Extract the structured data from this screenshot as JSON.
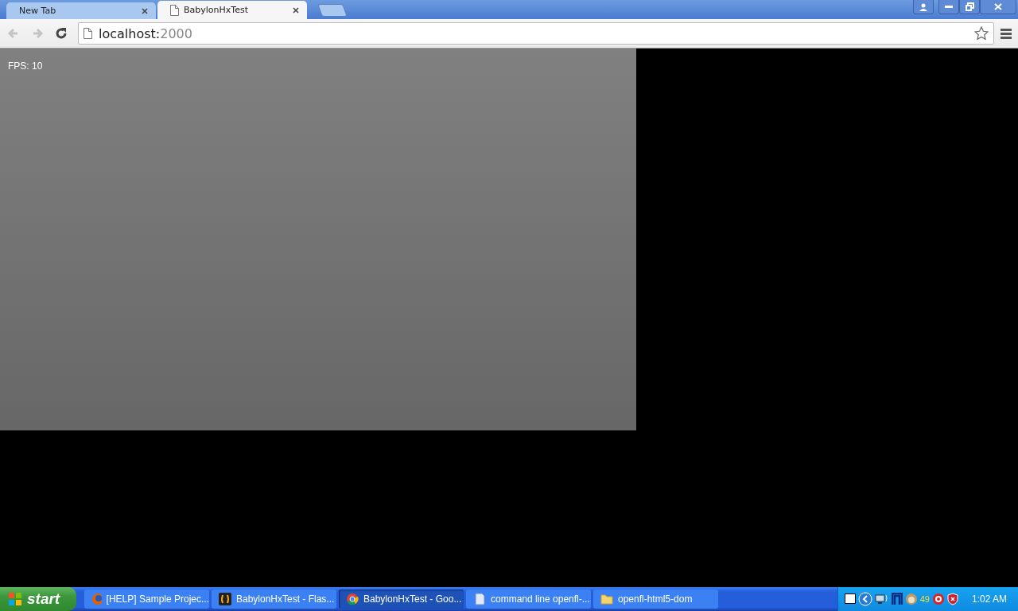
{
  "tabs": [
    {
      "title": "New Tab",
      "selected": false
    },
    {
      "title": "BabylonHxTest",
      "selected": true
    }
  ],
  "nav_buttons": [
    {
      "kind": "back",
      "disabled": true
    },
    {
      "kind": "forward",
      "disabled": true
    },
    {
      "kind": "reload",
      "disabled": false
    }
  ],
  "address": {
    "host": "localhost:",
    "port": "2000"
  },
  "page": {
    "fps": "FPS: 10"
  },
  "taskbar": {
    "start": "start",
    "items": [
      {
        "kind": "firefox",
        "label": "[HELP] Sample Projec...",
        "selected": false
      },
      {
        "kind": "flash",
        "label": "BabylonHxTest - Flas...",
        "selected": false
      },
      {
        "kind": "chrome",
        "label": "BabylonHxTest - Goo...",
        "selected": true
      },
      {
        "kind": "document",
        "label": "command line openfl-...",
        "selected": false
      },
      {
        "kind": "folder",
        "label": "openfl-html5-dom",
        "selected": false
      }
    ],
    "tray_count": "49",
    "clock": "1:02 AM"
  }
}
